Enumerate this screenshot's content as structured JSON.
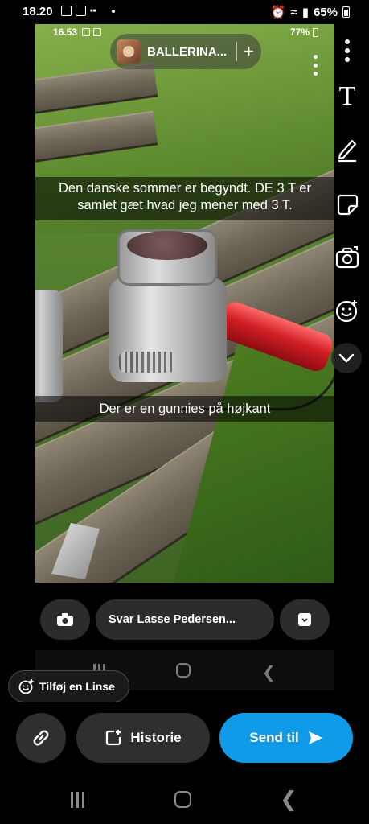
{
  "status_bar": {
    "time": "18.20",
    "battery": "65%"
  },
  "inner_status": {
    "time": "16.53",
    "battery": "77%"
  },
  "header": {
    "title": "BALLERINA...",
    "add_glyph": "+"
  },
  "captions": [
    "Den danske sommer er begyndt. DE 3 T er samlet gæt hvad jeg mener med 3 T.",
    "Der er en gunnies på højkant"
  ],
  "tools": {
    "text_glyph": "T"
  },
  "reply": {
    "placeholder": "Svar Lasse Pedersen..."
  },
  "lens_chip": {
    "label": "Tilføj en Linse"
  },
  "actions": {
    "story_label": "Historie",
    "send_label": "Send til"
  },
  "colors": {
    "send_blue": "#109be8",
    "pill_bg": "#2f2f2f"
  }
}
